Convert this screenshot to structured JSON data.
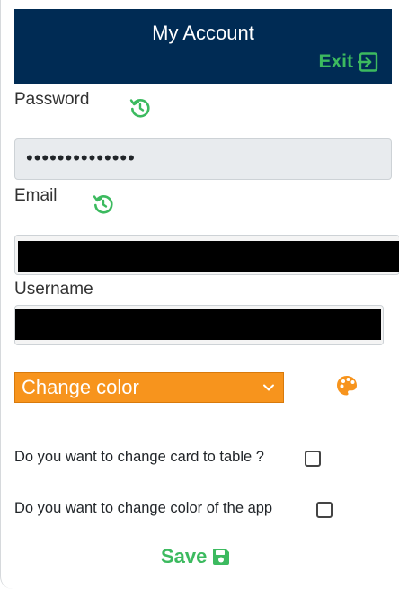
{
  "header": {
    "title": "My Account",
    "exit_label": "Exit"
  },
  "password": {
    "label": "Password",
    "value": "••••••••••••••"
  },
  "email": {
    "label": "Email"
  },
  "username": {
    "label": "Username"
  },
  "color_select": {
    "selected": "Change color"
  },
  "questions": {
    "card_to_table": "Do you want to change card to table ?",
    "change_app_color": "Do you want to change color of the app"
  },
  "save_label": "Save",
  "colors": {
    "header_bg": "#002b54",
    "accent_green": "#3cba5f",
    "select_orange": "#f7941d"
  }
}
